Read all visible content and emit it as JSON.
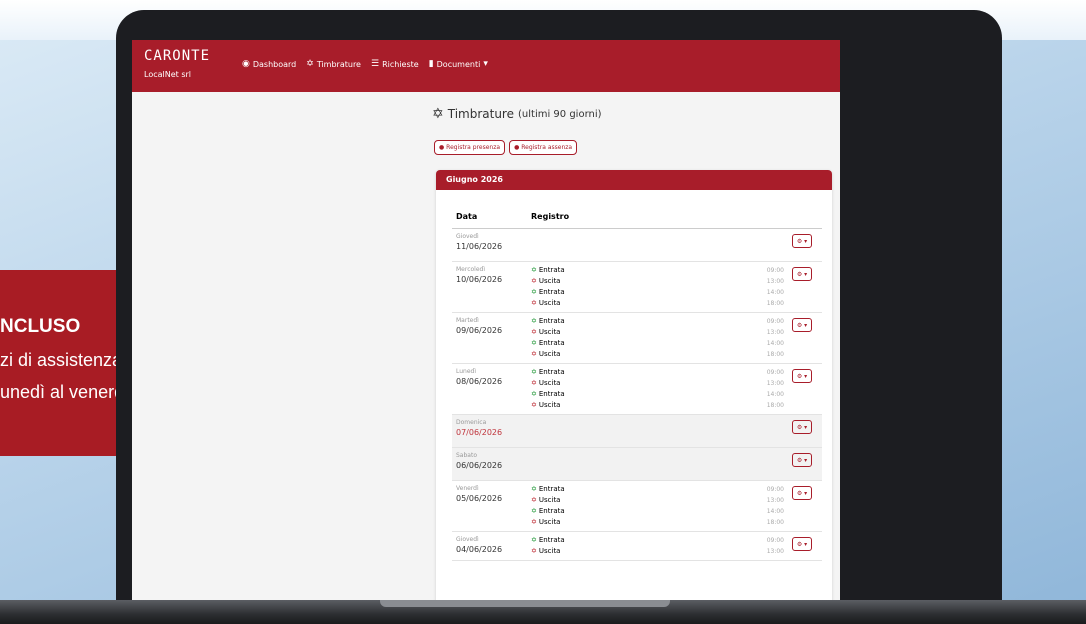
{
  "promo": {
    "line1": "NCLUSO",
    "line2": "zi di assistenza",
    "line3": "unedì al venerdì"
  },
  "navbar": {
    "brand": "CARONTE",
    "company": "LocalNet srl",
    "items": [
      {
        "label": "Dashboard",
        "icon": "dashboard-icon"
      },
      {
        "label": "Timbrature",
        "icon": "walking-icon"
      },
      {
        "label": "Richieste",
        "icon": "list-icon"
      },
      {
        "label": "Documenti",
        "icon": "file-icon"
      }
    ]
  },
  "page": {
    "title": "Timbrature",
    "subtitle": "(ultimi 90 giorni)",
    "btn_presenza": "Registra presenza",
    "btn_assenza": "Registra assenza"
  },
  "card": {
    "month": "Giugno 2026",
    "columns": {
      "data": "Data",
      "registro": "Registro"
    },
    "rows": [
      {
        "day": "Giovedì",
        "date": "11/06/2026",
        "entries": [],
        "holiday": false,
        "alt": false
      },
      {
        "day": "Mercoledì",
        "date": "10/06/2026",
        "holiday": false,
        "alt": false,
        "entries": [
          {
            "type": "in",
            "label": "Entrata",
            "time": "09:00"
          },
          {
            "type": "out",
            "label": "Uscita",
            "time": "13:00"
          },
          {
            "type": "in",
            "label": "Entrata",
            "time": "14:00"
          },
          {
            "type": "out",
            "label": "Uscita",
            "time": "18:00"
          }
        ]
      },
      {
        "day": "Martedì",
        "date": "09/06/2026",
        "holiday": false,
        "alt": false,
        "entries": [
          {
            "type": "in",
            "label": "Entrata",
            "time": "09:00"
          },
          {
            "type": "out",
            "label": "Uscita",
            "time": "13:00"
          },
          {
            "type": "in",
            "label": "Entrata",
            "time": "14:00"
          },
          {
            "type": "out",
            "label": "Uscita",
            "time": "18:00"
          }
        ]
      },
      {
        "day": "Lunedì",
        "date": "08/06/2026",
        "holiday": false,
        "alt": false,
        "entries": [
          {
            "type": "in",
            "label": "Entrata",
            "time": "09:00"
          },
          {
            "type": "out",
            "label": "Uscita",
            "time": "13:00"
          },
          {
            "type": "in",
            "label": "Entrata",
            "time": "14:00"
          },
          {
            "type": "out",
            "label": "Uscita",
            "time": "18:00"
          }
        ]
      },
      {
        "day": "Domenica",
        "date": "07/06/2026",
        "entries": [],
        "holiday": true,
        "alt": true
      },
      {
        "day": "Sabato",
        "date": "06/06/2026",
        "entries": [],
        "holiday": false,
        "alt": true
      },
      {
        "day": "Venerdì",
        "date": "05/06/2026",
        "holiday": false,
        "alt": false,
        "entries": [
          {
            "type": "in",
            "label": "Entrata",
            "time": "09:00"
          },
          {
            "type": "out",
            "label": "Uscita",
            "time": "13:00"
          },
          {
            "type": "in",
            "label": "Entrata",
            "time": "14:00"
          },
          {
            "type": "out",
            "label": "Uscita",
            "time": "18:00"
          }
        ]
      },
      {
        "day": "Giovedì",
        "date": "04/06/2026",
        "holiday": false,
        "alt": false,
        "entries": [
          {
            "type": "in",
            "label": "Entrata",
            "time": "09:00"
          },
          {
            "type": "out",
            "label": "Uscita",
            "time": "13:00"
          }
        ]
      }
    ]
  },
  "colors": {
    "brand": "#a81d2a",
    "entry": "#2f9e44",
    "exit": "#c0343c"
  }
}
